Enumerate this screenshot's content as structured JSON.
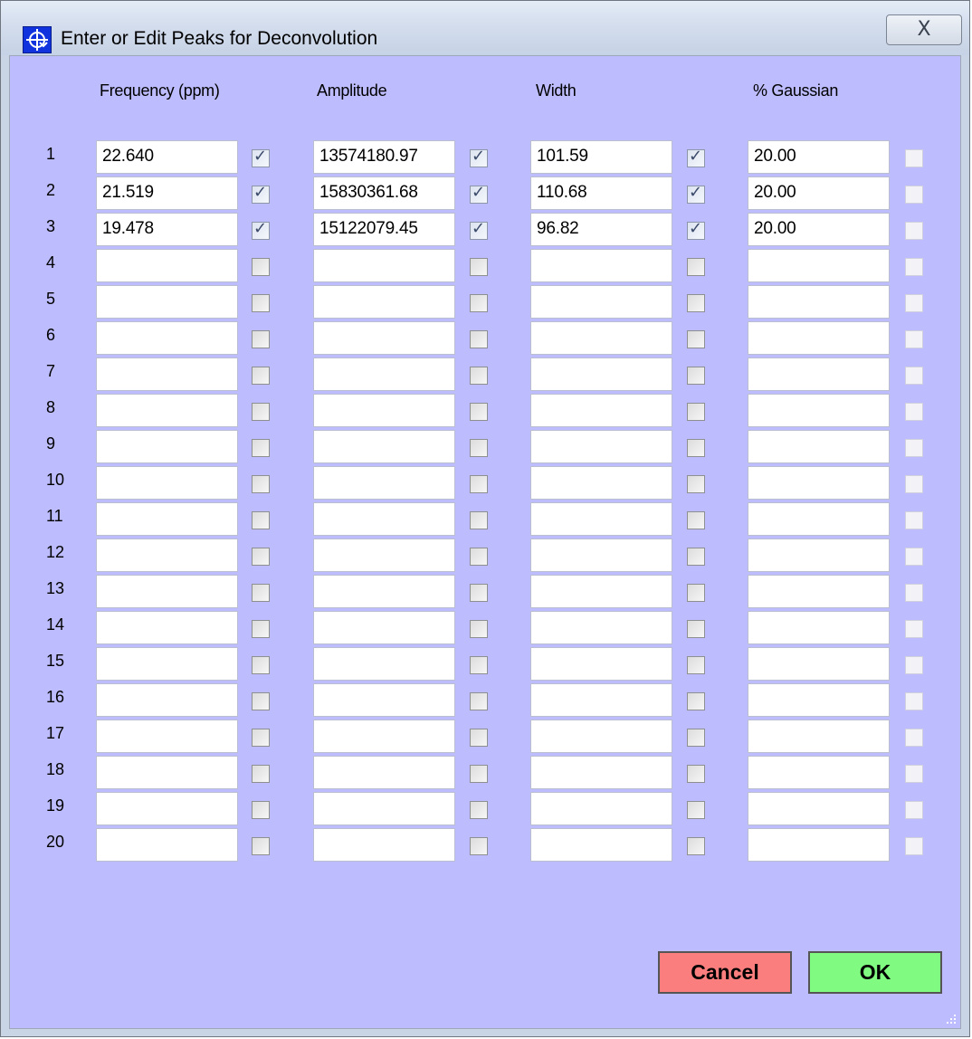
{
  "window": {
    "title": "Enter or Edit Peaks for Deconvolution",
    "close_label": "X"
  },
  "headers": {
    "frequency": "Frequency (ppm)",
    "amplitude": "Amplitude",
    "width": "Width",
    "gaussian": "% Gaussian"
  },
  "rows": [
    {
      "num": "1",
      "frequency": "22.640",
      "frequency_checked": true,
      "amplitude": "13574180.97",
      "amplitude_checked": true,
      "width": "101.59",
      "width_checked": true,
      "gaussian": "20.00",
      "gaussian_checked": false
    },
    {
      "num": "2",
      "frequency": "21.519",
      "frequency_checked": true,
      "amplitude": "15830361.68",
      "amplitude_checked": true,
      "width": "110.68",
      "width_checked": true,
      "gaussian": "20.00",
      "gaussian_checked": false
    },
    {
      "num": "3",
      "frequency": "19.478",
      "frequency_checked": true,
      "amplitude": "15122079.45",
      "amplitude_checked": true,
      "width": "96.82",
      "width_checked": true,
      "gaussian": "20.00",
      "gaussian_checked": false
    },
    {
      "num": "4",
      "frequency": "",
      "frequency_checked": false,
      "amplitude": "",
      "amplitude_checked": false,
      "width": "",
      "width_checked": false,
      "gaussian": "",
      "gaussian_checked": false
    },
    {
      "num": "5",
      "frequency": "",
      "frequency_checked": false,
      "amplitude": "",
      "amplitude_checked": false,
      "width": "",
      "width_checked": false,
      "gaussian": "",
      "gaussian_checked": false
    },
    {
      "num": "6",
      "frequency": "",
      "frequency_checked": false,
      "amplitude": "",
      "amplitude_checked": false,
      "width": "",
      "width_checked": false,
      "gaussian": "",
      "gaussian_checked": false
    },
    {
      "num": "7",
      "frequency": "",
      "frequency_checked": false,
      "amplitude": "",
      "amplitude_checked": false,
      "width": "",
      "width_checked": false,
      "gaussian": "",
      "gaussian_checked": false
    },
    {
      "num": "8",
      "frequency": "",
      "frequency_checked": false,
      "amplitude": "",
      "amplitude_checked": false,
      "width": "",
      "width_checked": false,
      "gaussian": "",
      "gaussian_checked": false
    },
    {
      "num": "9",
      "frequency": "",
      "frequency_checked": false,
      "amplitude": "",
      "amplitude_checked": false,
      "width": "",
      "width_checked": false,
      "gaussian": "",
      "gaussian_checked": false
    },
    {
      "num": "10",
      "frequency": "",
      "frequency_checked": false,
      "amplitude": "",
      "amplitude_checked": false,
      "width": "",
      "width_checked": false,
      "gaussian": "",
      "gaussian_checked": false
    },
    {
      "num": "11",
      "frequency": "",
      "frequency_checked": false,
      "amplitude": "",
      "amplitude_checked": false,
      "width": "",
      "width_checked": false,
      "gaussian": "",
      "gaussian_checked": false
    },
    {
      "num": "12",
      "frequency": "",
      "frequency_checked": false,
      "amplitude": "",
      "amplitude_checked": false,
      "width": "",
      "width_checked": false,
      "gaussian": "",
      "gaussian_checked": false
    },
    {
      "num": "13",
      "frequency": "",
      "frequency_checked": false,
      "amplitude": "",
      "amplitude_checked": false,
      "width": "",
      "width_checked": false,
      "gaussian": "",
      "gaussian_checked": false
    },
    {
      "num": "14",
      "frequency": "",
      "frequency_checked": false,
      "amplitude": "",
      "amplitude_checked": false,
      "width": "",
      "width_checked": false,
      "gaussian": "",
      "gaussian_checked": false
    },
    {
      "num": "15",
      "frequency": "",
      "frequency_checked": false,
      "amplitude": "",
      "amplitude_checked": false,
      "width": "",
      "width_checked": false,
      "gaussian": "",
      "gaussian_checked": false
    },
    {
      "num": "16",
      "frequency": "",
      "frequency_checked": false,
      "amplitude": "",
      "amplitude_checked": false,
      "width": "",
      "width_checked": false,
      "gaussian": "",
      "gaussian_checked": false
    },
    {
      "num": "17",
      "frequency": "",
      "frequency_checked": false,
      "amplitude": "",
      "amplitude_checked": false,
      "width": "",
      "width_checked": false,
      "gaussian": "",
      "gaussian_checked": false
    },
    {
      "num": "18",
      "frequency": "",
      "frequency_checked": false,
      "amplitude": "",
      "amplitude_checked": false,
      "width": "",
      "width_checked": false,
      "gaussian": "",
      "gaussian_checked": false
    },
    {
      "num": "19",
      "frequency": "",
      "frequency_checked": false,
      "amplitude": "",
      "amplitude_checked": false,
      "width": "",
      "width_checked": false,
      "gaussian": "",
      "gaussian_checked": false
    },
    {
      "num": "20",
      "frequency": "",
      "frequency_checked": false,
      "amplitude": "",
      "amplitude_checked": false,
      "width": "",
      "width_checked": false,
      "gaussian": "",
      "gaussian_checked": false
    }
  ],
  "buttons": {
    "cancel": "Cancel",
    "ok": "OK"
  },
  "colors": {
    "client_bg": "#bcbcfe",
    "cancel_bg": "#fb7e7e",
    "ok_bg": "#80fa80",
    "icon_bg": "#1133dd"
  },
  "icons": {
    "app": "deconvolution-app-icon",
    "close": "close-icon",
    "check": "check-mark-icon",
    "resize": "resize-grip-icon"
  }
}
